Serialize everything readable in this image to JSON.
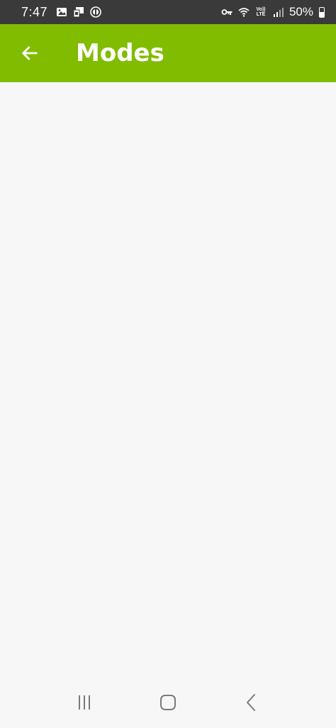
{
  "status_bar": {
    "time": "7:47",
    "battery_percent": "50%",
    "battery_level": 0.5,
    "lte_top": "Vo))",
    "lte_bottom": "LTE",
    "icons_left": [
      "gallery-icon",
      "sim-card-icon",
      "app-notification-icon"
    ],
    "icons_right": [
      "vpn-key-icon",
      "wifi-icon",
      "volte-icon",
      "signal-icon",
      "battery-icon"
    ]
  },
  "app_bar": {
    "title": "Modes",
    "background": "#82bc00",
    "back_icon": "arrow-back-icon"
  },
  "nav_bar": {
    "buttons": [
      "recents-icon",
      "home-icon",
      "back-icon"
    ]
  }
}
